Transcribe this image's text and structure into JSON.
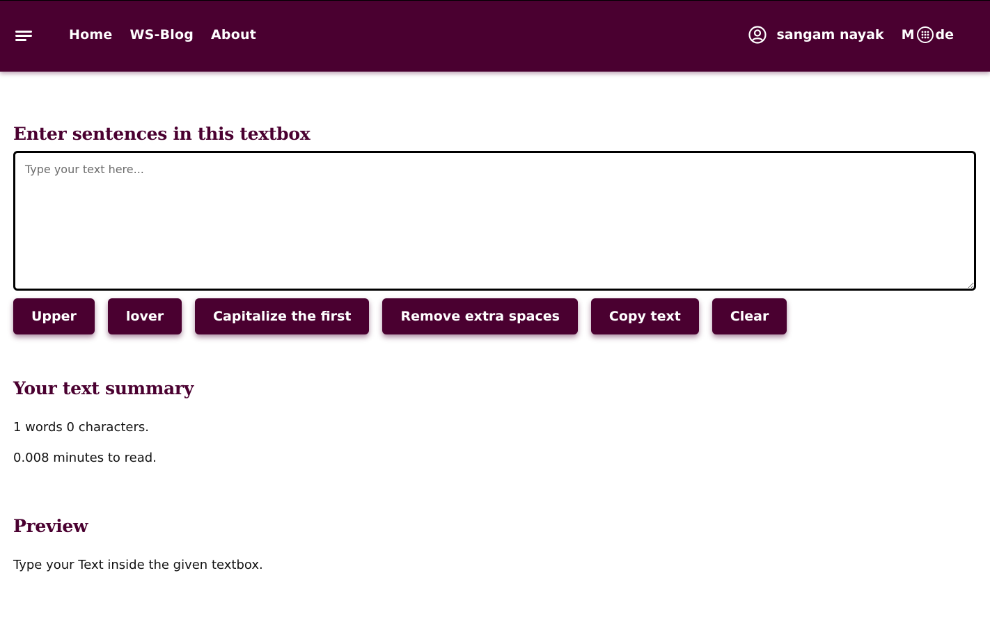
{
  "nav": {
    "links": [
      "Home",
      "WS-Blog",
      "About"
    ],
    "user_name": "sangam nayak",
    "mode_prefix": "M",
    "mode_suffix": "de"
  },
  "editor": {
    "heading": "Enter sentences in this textbox",
    "placeholder": "Type your text here...",
    "value": ""
  },
  "buttons": {
    "upper": "Upper",
    "lower": "lover",
    "capitalize": "Capitalize the first",
    "remove_spaces": "Remove extra spaces",
    "copy": "Copy text",
    "clear": "Clear"
  },
  "summary": {
    "heading": "Your text summary",
    "count_line": "1 words 0 characters.",
    "read_time_line": "0.008 minutes to read."
  },
  "preview": {
    "heading": "Preview",
    "text": "Type your Text inside the given textbox."
  },
  "colors": {
    "primary": "#4a0030",
    "background": "#ffffff"
  },
  "icons": {
    "menu": "hamburger-menu-icon",
    "user": "user-circle-icon",
    "mode": "mode-toggle-icon"
  }
}
